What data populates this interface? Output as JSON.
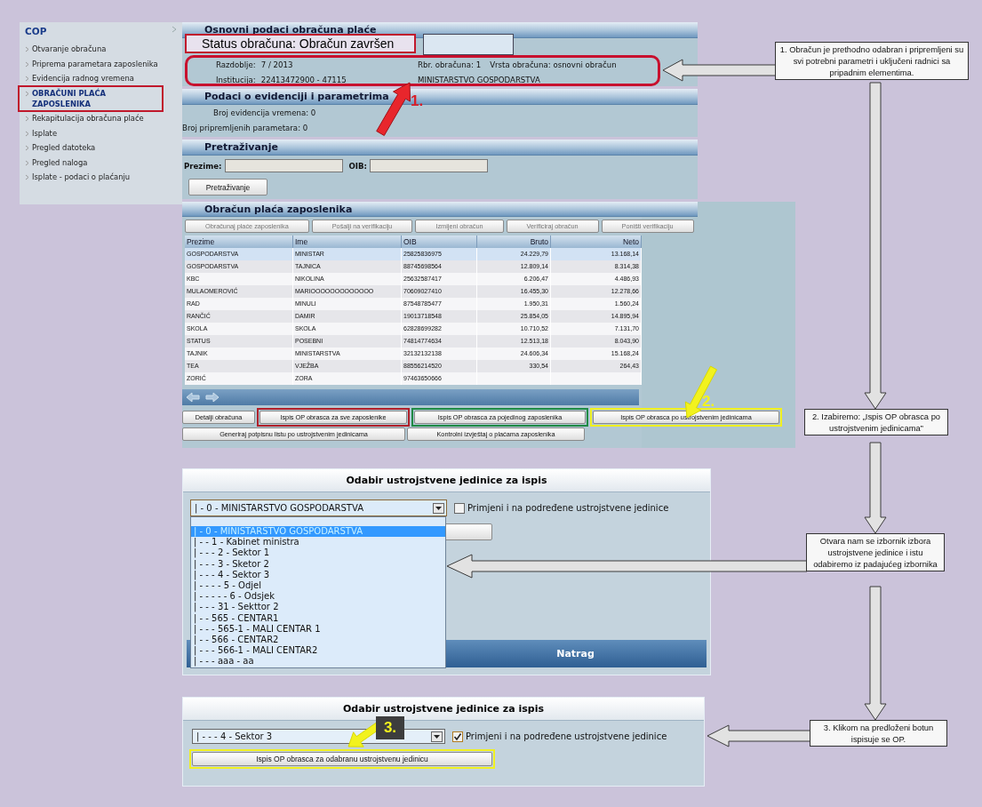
{
  "sidebar": {
    "title": "COP",
    "items": [
      {
        "label": "Otvaranje obračuna",
        "selected": false
      },
      {
        "label": "Priprema parametara zaposlenika",
        "selected": false
      },
      {
        "label": "Evidencija radnog vremena",
        "selected": false
      },
      {
        "label": "OBRAČUNI PLAĆA ZAPOSLENIKA",
        "selected": true
      },
      {
        "label": "Rekapitulacija obračuna plaće",
        "selected": false
      },
      {
        "label": "Isplate",
        "selected": false
      },
      {
        "label": "Pregled datoteka",
        "selected": false
      },
      {
        "label": "Pregled naloga",
        "selected": false
      },
      {
        "label": "Isplate - podaci o plaćanju",
        "selected": false
      }
    ]
  },
  "basic_data": {
    "header": "Osnovni podaci obračuna plaće",
    "status": "Status obračuna: Obračun završen",
    "left": [
      {
        "label": "Razdoblje:",
        "value": "7 / 2013"
      },
      {
        "label": "Institucija:",
        "value": "22413472900 - 47115"
      }
    ],
    "right": [
      [
        "Rbr. obračuna: 1",
        "Vrsta obračuna: osnovni obračun"
      ],
      [
        "MINISTARSTVO GOSPODARSTVA"
      ]
    ]
  },
  "records": {
    "header": "Podaci o evidenciji i parametrima",
    "lines": [
      "Broj evidencija vremena: 0",
      "Broj pripremljenih parametara: 0"
    ]
  },
  "search": {
    "header": "Pretraživanje",
    "fields": [
      {
        "label": "Prezime:"
      },
      {
        "label": "OIB:"
      }
    ],
    "button": "Pretraživanje"
  },
  "payroll": {
    "header": "Obračun plaća zaposlenika",
    "toolbar": [
      {
        "label": "Obračunaj plaće zaposlenika",
        "disabled": true
      },
      {
        "label": "Pošalji na verifikaciju",
        "disabled": true
      },
      {
        "label": "Izmijeni obračun",
        "disabled": true
      },
      {
        "label": "Verificiraj obračun",
        "disabled": true
      },
      {
        "label": "Poništi verifikaciju",
        "disabled": true
      }
    ],
    "columns": [
      "Prezime",
      "Ime",
      "OIB",
      "Bruto",
      "Neto"
    ],
    "rows": [
      {
        "cells": [
          "GOSPODARSTVA",
          "MINISTAR",
          "25825836975",
          "24.229,79",
          "13.168,14"
        ],
        "selected": true
      },
      {
        "cells": [
          "GOSPODARSTVA",
          "TAJNICA",
          "88745698564",
          "12.809,14",
          "8.314,38"
        ],
        "selected": false
      },
      {
        "cells": [
          "KBC",
          "NIKOLINA",
          "25632587417",
          "6.206,47",
          "4.486,93"
        ],
        "selected": false
      },
      {
        "cells": [
          "MULAOMEROVIĆ",
          "MARIOOOOOOOOOOOOO",
          "70609027410",
          "16.455,30",
          "12.278,66"
        ],
        "selected": false
      },
      {
        "cells": [
          "RAD",
          "MINULI",
          "87548785477",
          "1.950,31",
          "1.560,24"
        ],
        "selected": false
      },
      {
        "cells": [
          "RANČIĆ",
          "DAMIR",
          "19013718548",
          "25.854,05",
          "14.895,94"
        ],
        "selected": false
      },
      {
        "cells": [
          "SKOLA",
          "SKOLA",
          "62828699282",
          "10.710,52",
          "7.131,70"
        ],
        "selected": false
      },
      {
        "cells": [
          "STATUS",
          "POSEBNI",
          "74814774634",
          "12.513,18",
          "8.043,90"
        ],
        "selected": false
      },
      {
        "cells": [
          "TAJNIK",
          "MINISTARSTVA",
          "32132132138",
          "24.606,34",
          "15.168,24"
        ],
        "selected": false
      },
      {
        "cells": [
          "TEA",
          "VJEŽBA",
          "88556214520",
          "330,54",
          "264,43"
        ],
        "selected": false
      },
      {
        "cells": [
          "ZORIĆ",
          "ZORA",
          "97463650666"
        ],
        "selected": false
      }
    ],
    "actions": [
      [
        {
          "label": "Detalji obračuna"
        },
        {
          "label": "Ispis OP obrasca za sve zaposlenike",
          "color": "#b0202a"
        },
        {
          "label": "Ispis OP obrasca za pojedinog zaposlenika",
          "color": "#1f8a45"
        },
        {
          "label": "Ispis OP obrasca po ustrojstvenim jedinicama",
          "color": "#f0f020"
        }
      ],
      [
        {
          "label": "Generiraj potpisnu listu po ustrojstvenim jedinicama"
        },
        {
          "label": "Kontrolni izvještaj o plaćama zaposlenika"
        }
      ]
    ]
  },
  "unit_dialog": {
    "title": "Odabir ustrojstvene jedinice za ispis",
    "select": "| - 0 - MINISTARSTVO GOSPODARSTVA",
    "checkbox": {
      "label": "Primjeni i na podređene ustrojstvene jedinice",
      "checked": false
    },
    "options": [
      {
        "label": "| - 0 - MINISTARSTVO GOSPODARSTVA",
        "selected": true
      },
      {
        "label": "| - - 1 - Kabinet ministra",
        "selected": false
      },
      {
        "label": "| - - - 2 - Sektor 1",
        "selected": false
      },
      {
        "label": "| - - - 3 - Sketor 2",
        "selected": false
      },
      {
        "label": "| - - - 4 - Sektor 3",
        "selected": false
      },
      {
        "label": "| - - - - 5 - Odjel",
        "selected": false
      },
      {
        "label": "| - - - - - 6 - Odsjek",
        "selected": false
      },
      {
        "label": "| - - - 31 - Sekttor 2",
        "selected": false
      },
      {
        "label": "| - - 565 - CENTAR1",
        "selected": false
      },
      {
        "label": "| - - - 565-1 - MALI CENTAR 1",
        "selected": false
      },
      {
        "label": "| - - 566 - CENTAR2",
        "selected": false
      },
      {
        "label": "| - - - 566-1 - MALI CENTAR2",
        "selected": false
      },
      {
        "label": "| - - - aaa - aa",
        "selected": false
      }
    ],
    "back": "Natrag"
  },
  "unit_dialog_2": {
    "title": "Odabir ustrojstvene jedinice za ispis",
    "select": "| - - - 4 - Sektor 3",
    "checkbox": {
      "label": "Primjeni i na podređene ustrojstvene jedinice",
      "checked": true
    },
    "button": {
      "label": "Ispis OP obrasca za odabranu ustrojstvenu jedinicu",
      "color": "#f0f020"
    }
  },
  "annotations": {
    "callouts": [
      "1. Obračun je prethodno odabran i pripremljeni su svi potrebni parametri i uključeni radnici sa pripadnim elementima.",
      "2. Izabiremo:  „Ispis OP obrasca po ustrojstvenim jedinicama”",
      "Otvara nam se izbornik izbora ustrojstvene jedinice i istu odabiremo iz padajućeg izbornika",
      "3. Klikom na predloženi botun ispisuje se OP."
    ],
    "markers": [
      {
        "text": "1.",
        "color": "#d8202a"
      },
      {
        "text": "2.",
        "color": "#f2f21e"
      },
      {
        "text": "3.",
        "color": "#f2f21e"
      }
    ]
  }
}
